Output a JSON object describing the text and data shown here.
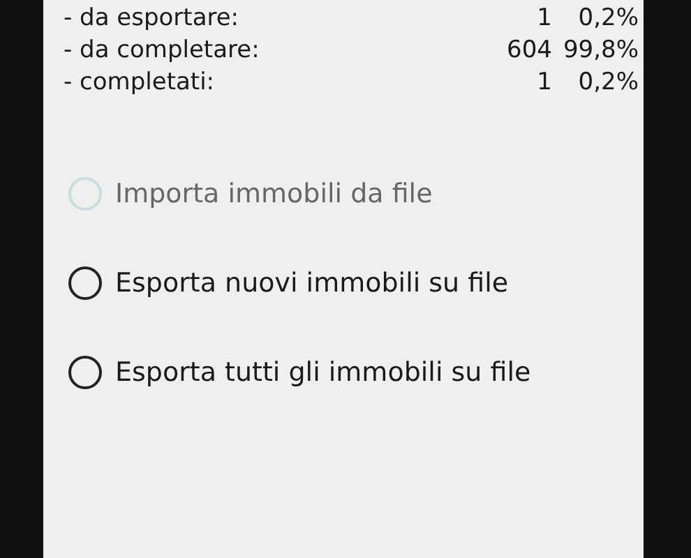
{
  "stats": [
    {
      "label": "- da esportare:",
      "count": "1",
      "percent": "0,2%"
    },
    {
      "label": "- da completare:",
      "count": "604",
      "percent": "99,8%"
    },
    {
      "label": "- completati:",
      "count": "1",
      "percent": "0,2%"
    }
  ],
  "options": [
    {
      "label": "Importa immobili da file",
      "disabled": true,
      "selected": false
    },
    {
      "label": "Esporta nuovi immobili su file",
      "disabled": false,
      "selected": false
    },
    {
      "label": "Esporta tutti gli immobili su file",
      "disabled": false,
      "selected": false
    }
  ]
}
